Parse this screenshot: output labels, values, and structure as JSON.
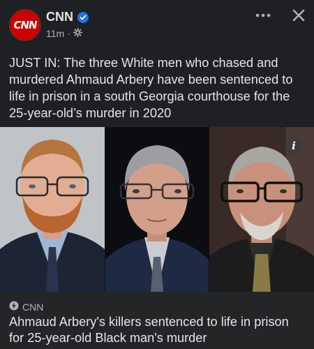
{
  "post": {
    "page_name": "CNN",
    "avatar_text": "CNN",
    "time": "11m",
    "separator": "·",
    "caption": "JUST IN: The three White men who chased and murdered Ahmaud Arbery have been sentenced to life in prison in a south Georgia courthouse for the 25-year-old’s murder in 2020"
  },
  "icons": {
    "verified": "verified-badge-icon",
    "audience": "globe-gear-icon",
    "more": "more-horizontal-icon",
    "close": "close-icon",
    "info": "info-icon",
    "source": "bolt-icon"
  },
  "link_preview": {
    "source": "CNN",
    "title": "Ahmaud Arbery's killers sentenced to life in prison for 25-year-old Black man's murder"
  },
  "colors": {
    "background": "#1f2023",
    "brand": "#cc0000",
    "verified": "#1b74e4"
  }
}
